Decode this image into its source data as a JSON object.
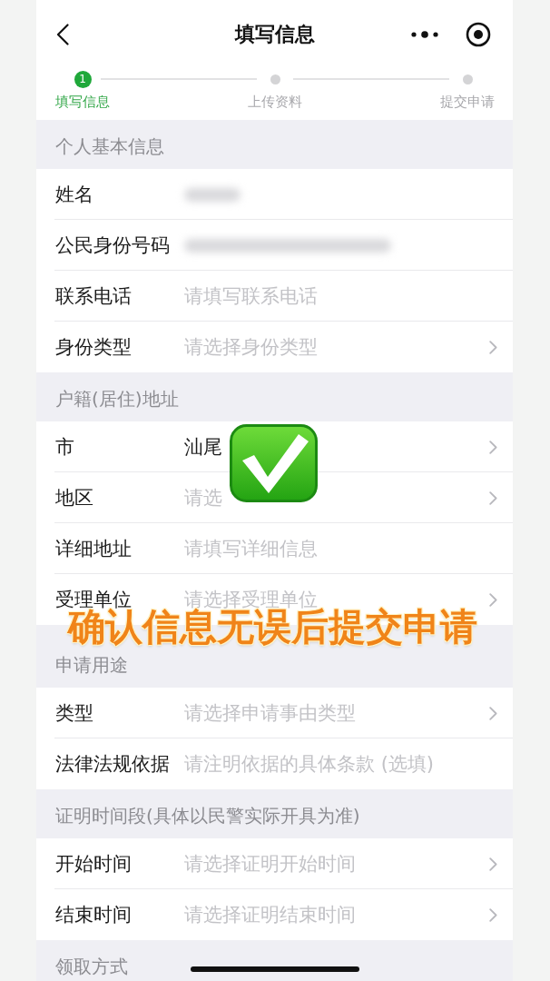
{
  "nav_bar": {
    "title": "填写信息"
  },
  "steps": [
    {
      "number": "1",
      "label": "填写信息",
      "selected": true
    },
    {
      "label": "上传资料",
      "selected": false
    },
    {
      "label": "提交申请",
      "selected": false
    }
  ],
  "sections": [
    {
      "title": "个人基本信息",
      "fields": [
        {
          "label": "姓名",
          "kind": "blurred"
        },
        {
          "label": "公民身份号码",
          "kind": "blurred"
        },
        {
          "label": "联系电话",
          "kind": "input",
          "placeholder": "请填写联系电话"
        },
        {
          "label": "身份类型",
          "kind": "select",
          "placeholder": "请选择身份类型"
        }
      ]
    },
    {
      "title": "户籍(居住)地址",
      "fields": [
        {
          "label": "市",
          "kind": "select",
          "value": "汕尾"
        },
        {
          "label": "地区",
          "kind": "select",
          "placeholder": "请选"
        },
        {
          "label": "详细地址",
          "kind": "input",
          "placeholder": "请填写详细信息"
        },
        {
          "label": "受理单位",
          "kind": "select",
          "placeholder": "请选择受理单位"
        }
      ]
    },
    {
      "title": "申请用途",
      "fields": [
        {
          "label": "类型",
          "kind": "select",
          "placeholder": "请选择申请事由类型"
        },
        {
          "label": "法律法规依据",
          "kind": "input",
          "placeholder": "请注明依据的具体条款 (选填)"
        }
      ]
    },
    {
      "title": "证明时间段(具体以民警实际开具为准)",
      "fields": [
        {
          "label": "开始时间",
          "kind": "select",
          "placeholder": "请选择证明开始时间"
        },
        {
          "label": "结束时间",
          "kind": "select",
          "placeholder": "请选择证明结束时间"
        }
      ]
    },
    {
      "title": "领取方式"
    }
  ],
  "overlay": {
    "caption": "确认信息无误后提交申请"
  }
}
